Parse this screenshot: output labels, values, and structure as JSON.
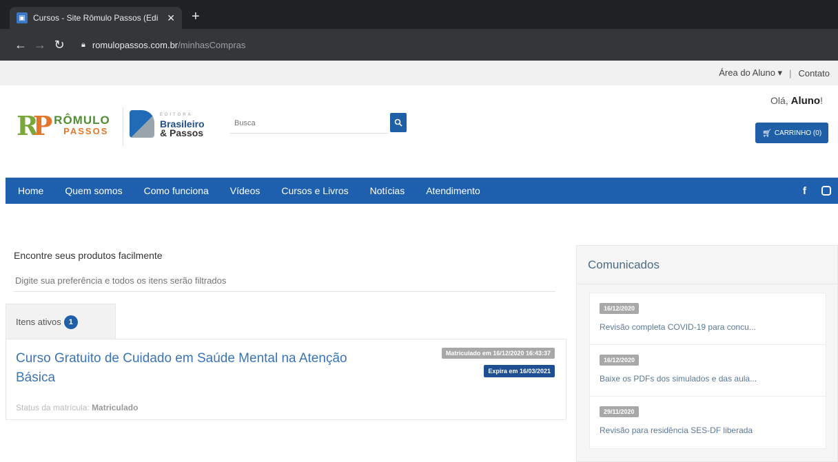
{
  "browser": {
    "tab_title": "Cursos - Site Rômulo Passos (Edi",
    "tab_close": "✕",
    "new_tab": "+",
    "url_domain": "romulopassos.com.br",
    "url_path": "/minhasCompras"
  },
  "topbar": {
    "area_aluno": "Área do Aluno ▾",
    "separator": "|",
    "contato": "Contato"
  },
  "header": {
    "logo1_top": "RÔMULO",
    "logo1_bottom": "PASSOS",
    "logo2_top": "EDITORA",
    "logo2_a": "Brasileiro",
    "logo2_b": "& Passos",
    "search_placeholder": "Busca",
    "greeting_prefix": "Olá, ",
    "greeting_name": "Aluno",
    "greeting_suffix": "!",
    "cart_label": "CARRINHO (0)"
  },
  "nav": {
    "items": [
      "Home",
      "Quem somos",
      "Como funciona",
      "Vídeos",
      "Cursos e Livros",
      "Notícias",
      "Atendimento"
    ],
    "facebook": "f"
  },
  "main": {
    "find_title": "Encontre seus produtos facilmente",
    "filter_placeholder": "Digite sua preferência e todos os itens serão filtrados",
    "tab_label": "Itens ativos",
    "tab_count": "1",
    "course": {
      "title": "Curso Gratuito de Cuidado em Saúde Mental na Atenção Básica",
      "enrolled_tag": "Matriculado em 16/12/2020 16:43:37",
      "expires_tag": "Expira em 16/03/2021",
      "status_label": "Status da matrícula: ",
      "status_value": "Matriculado"
    }
  },
  "comunicados": {
    "title": "Comunicados",
    "items": [
      {
        "date": "16/12/2020",
        "text": "Revisão completa COVID-19 para concu..."
      },
      {
        "date": "16/12/2020",
        "text": "Baixe os PDFs dos simulados e das aula..."
      },
      {
        "date": "29/11/2020",
        "text": "Revisão para residência SES-DF liberada"
      }
    ]
  },
  "colors": {
    "brand_blue": "#1e5fae",
    "tag_gray": "#a8a8a8",
    "tag_dark_blue": "#1e4f93"
  }
}
